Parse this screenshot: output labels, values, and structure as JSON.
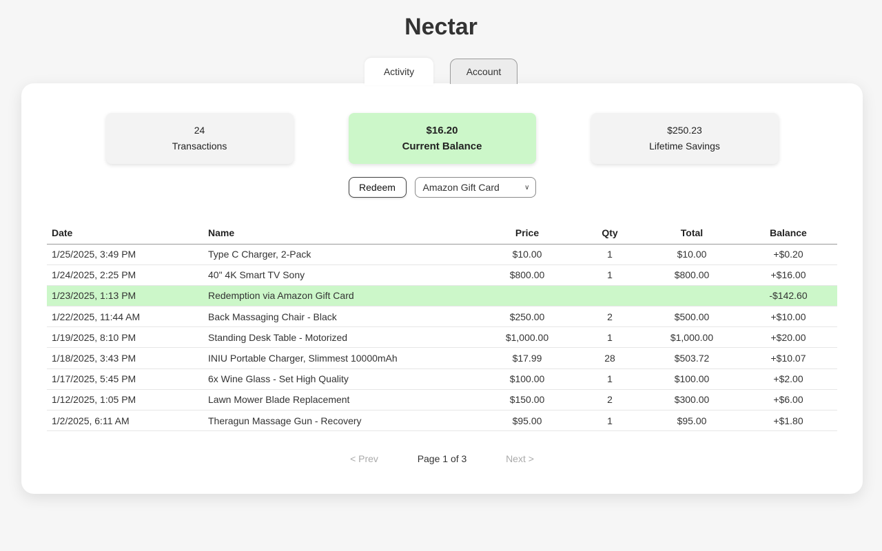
{
  "app": {
    "title": "Nectar"
  },
  "tabs": [
    {
      "label": "Activity",
      "active": true
    },
    {
      "label": "Account",
      "active": false
    }
  ],
  "stats": {
    "transactions": {
      "value": "24",
      "label": "Transactions"
    },
    "balance": {
      "value": "$16.20",
      "label": "Current Balance"
    },
    "savings": {
      "value": "$250.23",
      "label": "Lifetime Savings"
    }
  },
  "actions": {
    "redeem_label": "Redeem",
    "reward_select": "Amazon Gift Card"
  },
  "table": {
    "headers": [
      "Date",
      "Name",
      "Price",
      "Qty",
      "Total",
      "Balance"
    ],
    "rows": [
      {
        "date": "1/25/2025, 3:49 PM",
        "name": "Type C Charger, 2-Pack",
        "price": "$10.00",
        "qty": "1",
        "total": "$10.00",
        "balance": "+$0.20"
      },
      {
        "date": "1/24/2025, 2:25 PM",
        "name": "40\" 4K Smart TV Sony",
        "price": "$800.00",
        "qty": "1",
        "total": "$800.00",
        "balance": "+$16.00"
      },
      {
        "date": "1/23/2025, 1:13 PM",
        "name": "Redemption via Amazon Gift Card",
        "price": "",
        "qty": "",
        "total": "",
        "balance": "-$142.60"
      },
      {
        "date": "1/22/2025, 11:44 AM",
        "name": "Back Massaging Chair - Black",
        "price": "$250.00",
        "qty": "2",
        "total": "$500.00",
        "balance": "+$10.00"
      },
      {
        "date": "1/19/2025, 8:10 PM",
        "name": "Standing Desk Table - Motorized",
        "price": "$1,000.00",
        "qty": "1",
        "total": "$1,000.00",
        "balance": "+$20.00"
      },
      {
        "date": "1/18/2025, 3:43 PM",
        "name": "INIU Portable Charger, Slimmest 10000mAh",
        "price": "$17.99",
        "qty": "28",
        "total": "$503.72",
        "balance": "+$10.07"
      },
      {
        "date": "1/17/2025, 5:45 PM",
        "name": "6x Wine Glass - Set High Quality",
        "price": "$100.00",
        "qty": "1",
        "total": "$100.00",
        "balance": "+$2.00"
      },
      {
        "date": "1/12/2025, 1:05 PM",
        "name": "Lawn Mower Blade Replacement",
        "price": "$150.00",
        "qty": "2",
        "total": "$300.00",
        "balance": "+$6.00"
      },
      {
        "date": "1/2/2025, 6:11 AM",
        "name": "Theragun Massage Gun - Recovery",
        "price": "$95.00",
        "qty": "1",
        "total": "$95.00",
        "balance": "+$1.80"
      }
    ]
  },
  "pagination": {
    "prev": "< Prev",
    "info": "Page 1 of 3",
    "next": "Next >"
  },
  "colors": {
    "highlight": "#ccf7c9",
    "background": "#f6f6f6"
  }
}
